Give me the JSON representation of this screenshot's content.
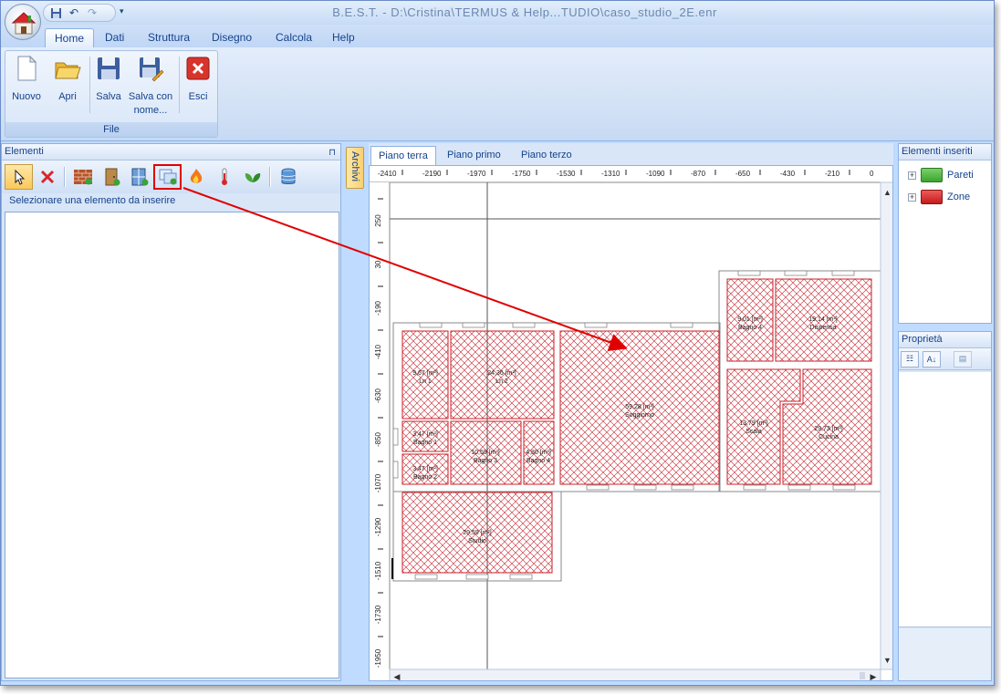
{
  "window": {
    "title": "B.E.S.T. - D:\\Cristina\\TERMUS & Help...TUDIO\\caso_studio_2E.enr"
  },
  "ribbon_tabs": [
    {
      "label": "Home",
      "active": true
    },
    {
      "label": "Dati"
    },
    {
      "label": "Struttura"
    },
    {
      "label": "Disegno"
    },
    {
      "label": "Calcola"
    },
    {
      "label": "Help"
    }
  ],
  "ribbon": {
    "group_label": "File",
    "buttons": {
      "nuovo": "Nuovo",
      "apri": "Apri",
      "salva": "Salva",
      "salva_con_1": "Salva con",
      "salva_con_2": "nome...",
      "esci": "Esci"
    }
  },
  "left_panel": {
    "title": "Elementi",
    "pin_glyph": "⊓",
    "hint": "Selezionare una elemento da inserire",
    "tools": [
      "pointer-icon",
      "delete-icon",
      "wall-icon",
      "door-icon",
      "window-icon",
      "zone-insert-icon",
      "flame-icon",
      "thermometer-icon",
      "plant-icon",
      "database-icon"
    ]
  },
  "archivi_label": "Archivi",
  "plan_tabs": [
    {
      "label": "Piano terra",
      "active": true
    },
    {
      "label": "Piano primo"
    },
    {
      "label": "Piano terzo"
    }
  ],
  "ruler": {
    "top": [
      "-2410",
      "-2190",
      "-1970",
      "-1750",
      "-1530",
      "-1310",
      "-1090",
      "-870",
      "-650",
      "-430",
      "-210",
      "0"
    ],
    "left": [
      "250",
      "30",
      "-190",
      "-410",
      "-630",
      "-850",
      "-1070",
      "-1290",
      "-1510",
      "-1730",
      "-1950"
    ]
  },
  "rooms": [
    {
      "id": "ln1",
      "area": "9,67 [m²]",
      "name": "Ln 1"
    },
    {
      "id": "ln2",
      "area": "24,36 [m²]",
      "name": "Ln 2"
    },
    {
      "id": "soggiorno",
      "area": "59,28 [m²]",
      "name": "Soggiorno"
    },
    {
      "id": "bagno4",
      "area": "9,01 [m²]",
      "name": "Bagno 4"
    },
    {
      "id": "dispensa",
      "area": "19,14 [m²]",
      "name": "Dispensa"
    },
    {
      "id": "bagno1",
      "area": "3,47 [m²]",
      "name": "Bagno 1"
    },
    {
      "id": "bagno2",
      "area": "3,47 [m²]",
      "name": "Bagno 2"
    },
    {
      "id": "bagno3",
      "area": "10,59 [m²]",
      "name": "Bagno 3"
    },
    {
      "id": "bagnox",
      "area": "4,80 [m²]",
      "name": "Bagno 4"
    },
    {
      "id": "scala",
      "area": "13,79 [m²]",
      "name": "Scala"
    },
    {
      "id": "cucina",
      "area": "29,73 [m²]",
      "name": "Cucina"
    },
    {
      "id": "studio",
      "area": "29,59 [m²]",
      "name": "Studio"
    }
  ],
  "elements_panel": {
    "title": "Elementi inseriti",
    "items": [
      {
        "label": "Pareti",
        "color": "#46b33a"
      },
      {
        "label": "Zone",
        "color": "#d42424"
      }
    ]
  },
  "props_panel": {
    "title": "Proprietà"
  },
  "colors": {
    "zone_hatch": "#c8202a",
    "annotation_arrow": "#e00000"
  }
}
